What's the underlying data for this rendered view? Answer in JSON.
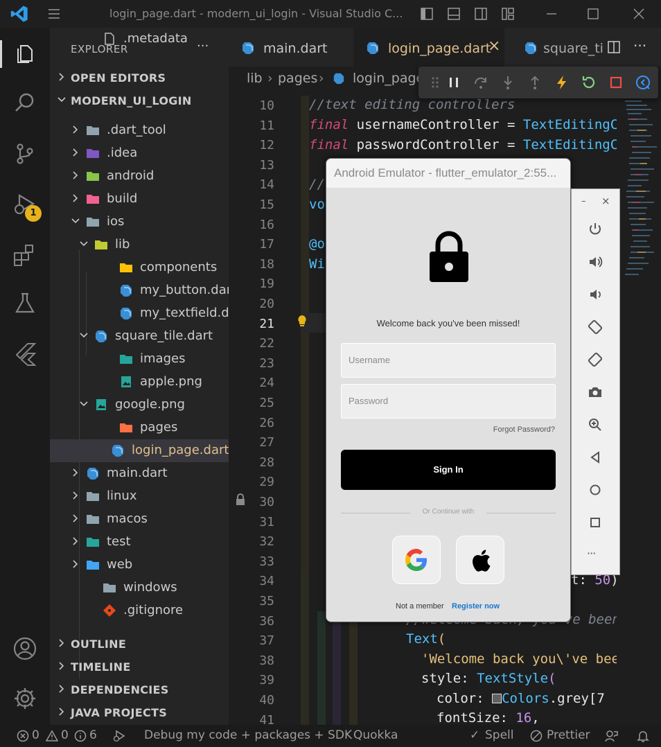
{
  "window": {
    "title": "login_page.dart - modern_ui_login - Visual Studio C..."
  },
  "activity_bar": {
    "icons": [
      "files-icon",
      "search-icon",
      "source-control-icon",
      "run-debug-icon",
      "extensions-icon",
      "testing-icon",
      "flutter-icon",
      "account-icon",
      "settings-gear-icon"
    ],
    "debug_badge": "1"
  },
  "explorer": {
    "header": "EXPLORER",
    "more": "···",
    "open_editors": "OPEN EDITORS",
    "project": "MODERN_UI_LOGIN",
    "items": [
      {
        "label": ".dart_tool",
        "icon": "folder-icon"
      },
      {
        "label": ".idea",
        "icon": "folder-idea-icon"
      },
      {
        "label": "android",
        "icon": "folder-android-icon"
      },
      {
        "label": "build",
        "icon": "folder-build-icon"
      },
      {
        "label": "ios",
        "icon": "folder-ios-icon"
      },
      {
        "label": "lib",
        "icon": "folder-lib-open-icon"
      },
      {
        "label": "components",
        "icon": "folder-components-open-icon"
      },
      {
        "label": "my_button.dart",
        "icon": "dart-file-icon"
      },
      {
        "label": "my_textfield.dart",
        "icon": "dart-file-icon"
      },
      {
        "label": "square_tile.dart",
        "icon": "dart-file-icon"
      },
      {
        "label": "images",
        "icon": "folder-images-open-icon"
      },
      {
        "label": "apple.png",
        "icon": "image-file-icon"
      },
      {
        "label": "google.png",
        "icon": "image-file-icon"
      },
      {
        "label": "pages",
        "icon": "folder-pages-open-icon"
      },
      {
        "label": "login_page.dart",
        "icon": "dart-file-icon"
      },
      {
        "label": "main.dart",
        "icon": "dart-file-icon"
      },
      {
        "label": "linux",
        "icon": "folder-icon"
      },
      {
        "label": "macos",
        "icon": "folder-icon"
      },
      {
        "label": "test",
        "icon": "folder-test-icon"
      },
      {
        "label": "web",
        "icon": "folder-web-icon"
      },
      {
        "label": "windows",
        "icon": "folder-icon"
      },
      {
        "label": ".gitignore",
        "icon": "git-icon"
      },
      {
        "label": ".metadata",
        "icon": "file-icon"
      }
    ],
    "sections": [
      "OUTLINE",
      "TIMELINE",
      "DEPENDENCIES",
      "JAVA PROJECTS"
    ]
  },
  "tabs": [
    {
      "label": "main.dart",
      "active": false
    },
    {
      "label": "login_page.dart",
      "active": true,
      "close": "×"
    },
    {
      "label": "square_til",
      "active": false
    }
  ],
  "breadcrumb": [
    "lib",
    "pages",
    "login_page"
  ],
  "editor": {
    "line_numbers": [
      "10",
      "11",
      "12",
      "13",
      "14",
      "15",
      "16",
      "17",
      "18",
      "19",
      "20",
      "21",
      "22",
      "23",
      "24",
      "25",
      "26",
      "27",
      "28",
      "29",
      "30",
      "31",
      "32",
      "33",
      "34",
      "35",
      "36",
      "37",
      "38",
      "39",
      "40",
      "41"
    ],
    "current_line": "21",
    "code": {
      "l10": "//text editing controllers",
      "l11_kw": "final",
      "l11_var": "usernameController",
      "l11_eq": "=",
      "l11_type": "TextEditingC",
      "l12_kw": "final",
      "l12_var": "passwordController",
      "l12_eq": "=",
      "l12_type": "TextEditingC",
      "l14": "//",
      "l15": "vo",
      "l17": "@o",
      "l18": "Wi",
      "l34_prop": "t:",
      "l34_num": "50",
      "l34_end": ")",
      "l36": "//welcome back, you've been",
      "l37_type": "Text",
      "l37_paren": "(",
      "l38_str": "'Welcome back you\\'ve bee",
      "l39_prop": "style:",
      "l39_type": "TextStyle",
      "l39_paren": "(",
      "l40_prop": "color:",
      "l40_type": "Colors",
      "l40_grey": ".grey[7",
      "l41_prop": "fontSize:",
      "l41_num": "16",
      "l41_comma": ","
    }
  },
  "emulator": {
    "title": "Android Emulator - flutter_emulator_2:55...",
    "welcome": "Welcome back you've been missed!",
    "username_placeholder": "Username",
    "password_placeholder": "Password",
    "forgot": "Forgot Password?",
    "sign_in": "Sign In",
    "or_continue": "Or Continue with",
    "not_member": "Not a member",
    "register": "Register now",
    "panel_min": "–",
    "panel_close": "×",
    "panel_more": "···"
  },
  "statusbar": {
    "errors": "0",
    "warnings": "0",
    "info": "6",
    "debug": "Debug my code + packages + SDK",
    "quokka": "Quokka",
    "spell": "Spell",
    "prettier": "Prettier"
  },
  "colors": {
    "accent": "#007acc",
    "keyword": "#d44a7a",
    "type": "#4fc1ff",
    "string": "#e6c07b",
    "active_tab_text": "#e2c08d",
    "register_link": "#1976d2"
  }
}
